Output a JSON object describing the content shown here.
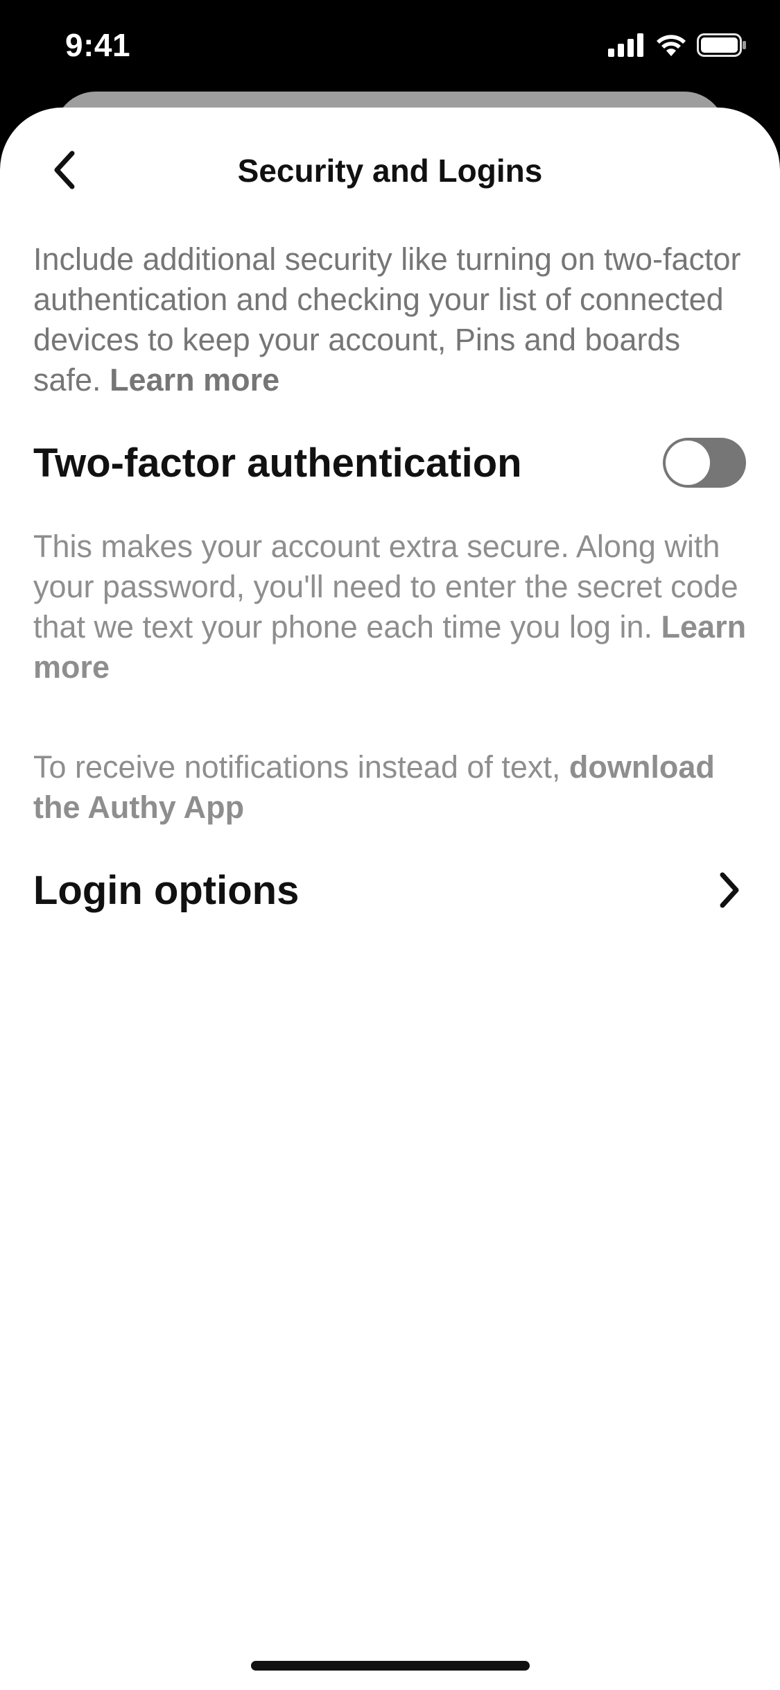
{
  "status_bar": {
    "time": "9:41",
    "icons": [
      "cellular-signal-icon",
      "wifi-icon",
      "battery-icon"
    ]
  },
  "nav": {
    "back_icon": "chevron-left-icon",
    "title": "Security and Logins"
  },
  "intro": {
    "text": "Include additional security like turning on two-factor authentication and checking your list of connected devices to keep your account, Pins and boards safe. ",
    "link": "Learn more"
  },
  "two_factor": {
    "title": "Two-factor authentication",
    "enabled": false,
    "description": "This makes your account extra secure. Along with your password, you'll need to enter the secret code that we text your phone each time you log in. ",
    "description_link": "Learn more",
    "authy_text": "To receive notifications instead of text, ",
    "authy_link": "download the Authy App"
  },
  "login_options": {
    "title": "Login options",
    "icon": "chevron-right-icon"
  },
  "colors": {
    "text_primary": "#111111",
    "text_secondary": "#767676",
    "toggle_off": "#767676",
    "background": "#ffffff"
  }
}
